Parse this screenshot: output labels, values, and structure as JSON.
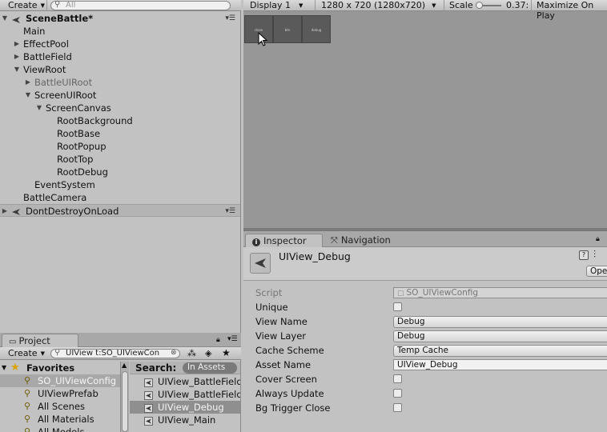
{
  "hierarchy": {
    "toolbar": {
      "create_label": "Create",
      "search_placeholder": "All"
    },
    "scene_name": "SceneBattle*",
    "items": [
      {
        "label": "Main"
      },
      {
        "label": "EffectPool"
      },
      {
        "label": "BattleField"
      },
      {
        "label": "ViewRoot"
      },
      {
        "label": "BattleUIRoot"
      },
      {
        "label": "ScreenUIRoot"
      },
      {
        "label": "ScreenCanvas"
      },
      {
        "label": "RootBackground"
      },
      {
        "label": "RootBase"
      },
      {
        "label": "RootPopup"
      },
      {
        "label": "RootTop"
      },
      {
        "label": "RootDebug"
      },
      {
        "label": "EventSystem"
      },
      {
        "label": "BattleCamera"
      },
      {
        "label": "DontDestroyOnLoad"
      }
    ]
  },
  "game": {
    "display": "Display 1",
    "resolution": "1280 x 720 (1280x720)",
    "scale_label": "Scale",
    "scale_value": "0.37:",
    "maximize": "Maximize On Play",
    "buttons": [
      {
        "label": "close"
      },
      {
        "label": "btn"
      },
      {
        "label": "debug"
      }
    ]
  },
  "inspector": {
    "tabs": [
      {
        "label": "Inspector"
      },
      {
        "label": "Navigation"
      }
    ],
    "object_name": "UIView_Debug",
    "open_label": "Ope",
    "props": [
      {
        "label": "Script",
        "value": "SO_UIViewConfig"
      },
      {
        "label": "Unique"
      },
      {
        "label": "View Name",
        "value": "Debug"
      },
      {
        "label": "View Layer",
        "value": "Debug"
      },
      {
        "label": "Cache Scheme",
        "value": "Temp Cache"
      },
      {
        "label": "Asset Name",
        "value": "UIView_Debug"
      },
      {
        "label": "Cover Screen"
      },
      {
        "label": "Always Update"
      },
      {
        "label": "Bg Trigger Close"
      }
    ]
  },
  "project": {
    "tab_label": "Project",
    "create_label": "Create",
    "search_value": "UIView t:SO_UIViewCon",
    "favorites_label": "Favorites",
    "favorites": [
      {
        "label": "SO_UIViewConfig"
      },
      {
        "label": "UIViewPrefab"
      },
      {
        "label": "All Scenes"
      },
      {
        "label": "All Materials"
      },
      {
        "label": "All Models"
      }
    ],
    "search_label": "Search:",
    "search_scope": "In Assets",
    "results": [
      {
        "label": "UIView_BattleField"
      },
      {
        "label": "UIView_BattleField"
      },
      {
        "label": "UIView_Debug"
      },
      {
        "label": "UIView_Main"
      }
    ]
  },
  "colors": {
    "panel": "#c2c2c2",
    "game_bg": "#979797",
    "selection": "#8f8f8f"
  }
}
